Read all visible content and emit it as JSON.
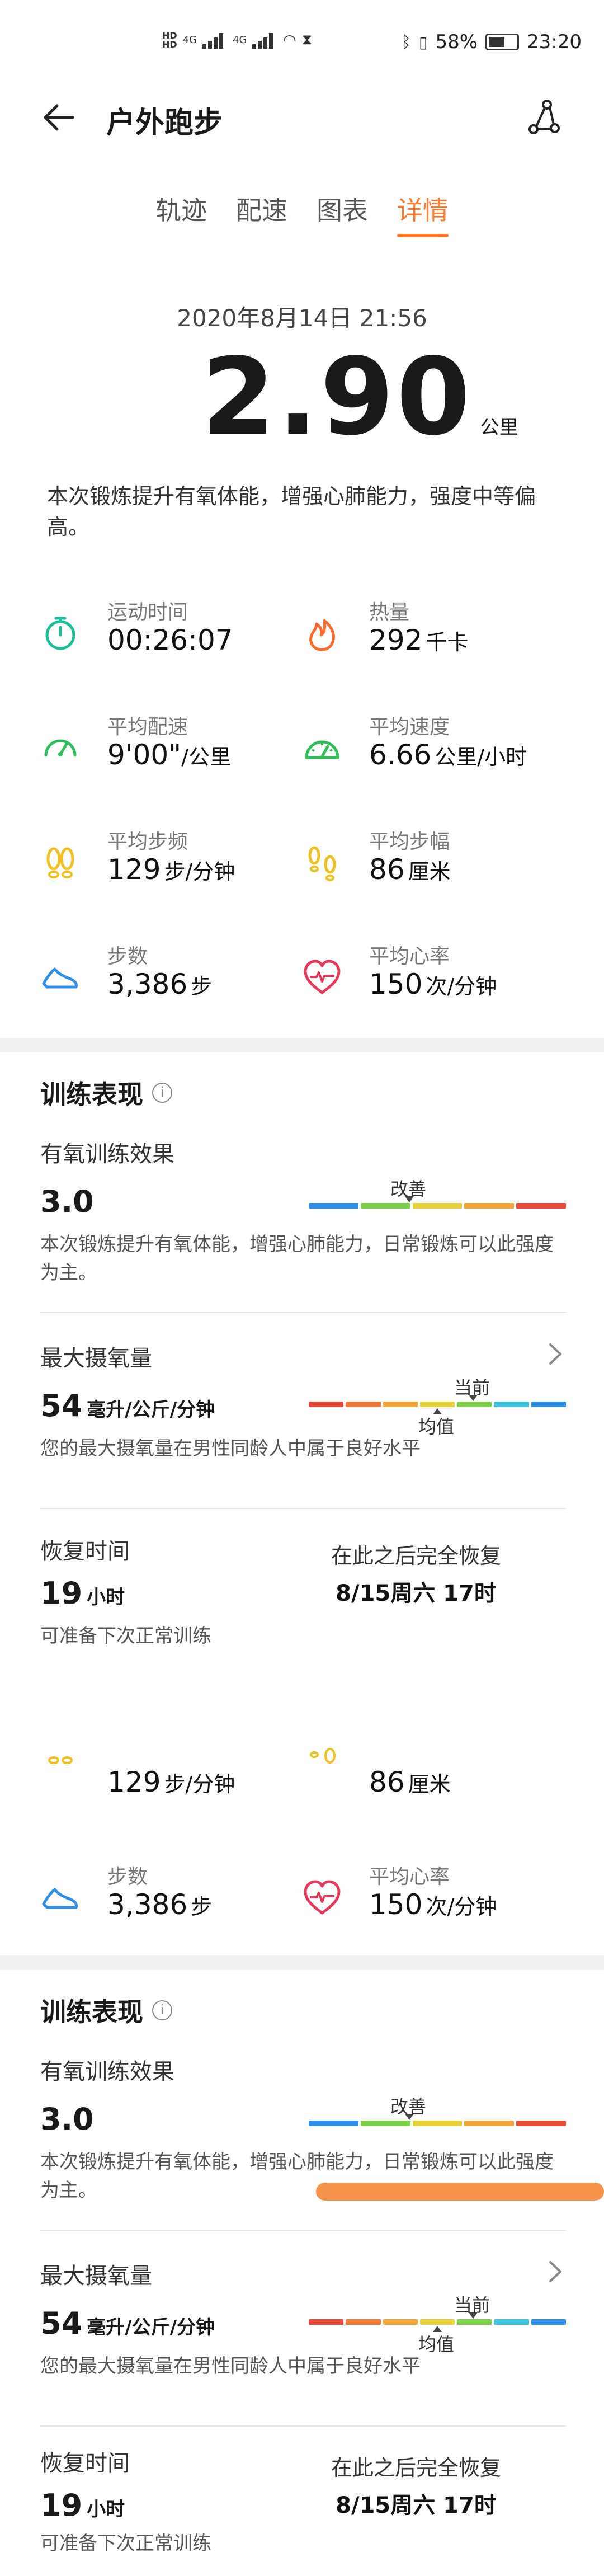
{
  "status_bar": {
    "battery": "58%",
    "time": "23:20",
    "net": "4G"
  },
  "app_bar": {
    "title": "户外跑步"
  },
  "tabs": [
    {
      "label": "轨迹"
    },
    {
      "label": "配速"
    },
    {
      "label": "图表"
    },
    {
      "label": "详情"
    }
  ],
  "active_tab": 3,
  "workout": {
    "date": "2020年8月14日 21:56",
    "distance": "2.90",
    "distance_unit": "公里",
    "summary": "本次锻炼提升有氧体能，增强心肺能力，强度中等偏高。"
  },
  "metrics": {
    "duration": {
      "label": "运动时间",
      "value": "00:26:07"
    },
    "calories": {
      "label": "热量",
      "value": "292",
      "unit": "千卡"
    },
    "pace": {
      "label": "平均配速",
      "value": "9'00\"",
      "unit": "/公里"
    },
    "speed": {
      "label": "平均速度",
      "value": "6.66",
      "unit": "公里/小时"
    },
    "cadence": {
      "label": "平均步频",
      "value": "129",
      "unit": "步/分钟"
    },
    "stride": {
      "label": "平均步幅",
      "value": "86",
      "unit": "厘米"
    },
    "steps": {
      "label": "步数",
      "value": "3,386",
      "unit": "步"
    },
    "heart_rate": {
      "label": "平均心率",
      "value": "150",
      "unit": "次/分钟"
    }
  },
  "training": {
    "title": "训练表现",
    "aerobic": {
      "label": "有氧训练效果",
      "value": "3.0",
      "scale_label": "改善",
      "desc": "本次锻炼提升有氧体能，增强心肺能力，日常锻炼可以此强度为主。"
    },
    "vo2max": {
      "label": "最大摄氧量",
      "value": "54",
      "unit": "毫升/公斤/分钟",
      "current_label": "当前",
      "avg_label": "均值",
      "desc": "您的最大摄氧量在男性同龄人中属于良好水平"
    },
    "recovery": {
      "label": "恢复时间",
      "value": "19",
      "unit": "小时",
      "after_label": "在此之后完全恢复",
      "after_value": "8/15周六 17时",
      "desc": "可准备下次正常训练"
    }
  },
  "colors": {
    "accent": "#ff7a2e",
    "aerobic_scale": [
      "#2f8fe8",
      "#7ed04b",
      "#e8d13a",
      "#f2a43a",
      "#e84a3a"
    ],
    "vo2_scale": [
      "#e84a3a",
      "#f07a3a",
      "#f2a43a",
      "#e8d13a",
      "#7ed04b",
      "#3fc4e0",
      "#2f8fe8"
    ]
  }
}
